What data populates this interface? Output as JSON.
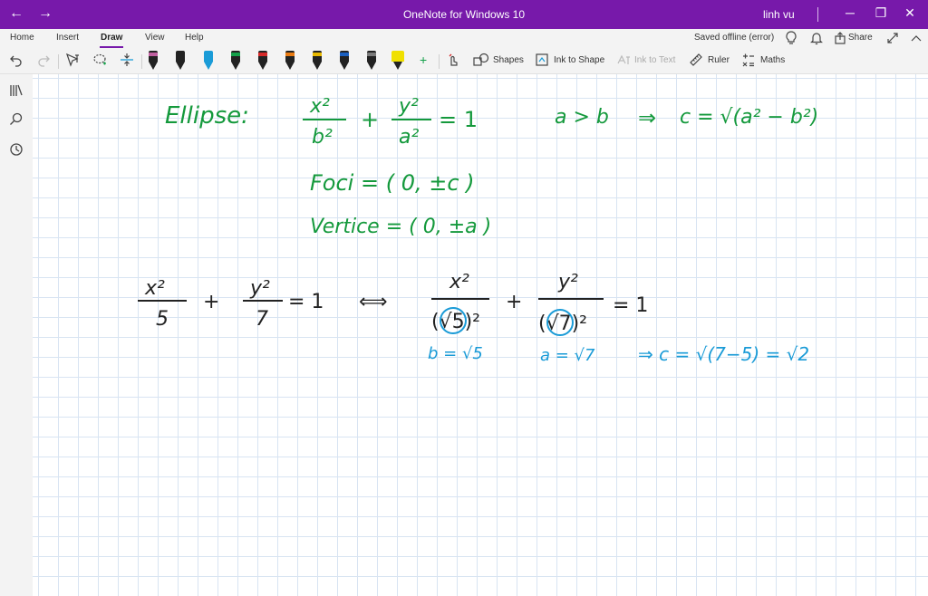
{
  "window": {
    "title": "OneNote for Windows 10",
    "user": "linh vu",
    "back_glyph": "←",
    "forward_glyph": "→",
    "minimize_glyph": "─",
    "restore_glyph": "❐",
    "close_glyph": "✕"
  },
  "menu": {
    "home": "Home",
    "insert": "Insert",
    "draw": "Draw",
    "view": "View",
    "help": "Help",
    "status": "Saved offline (error)",
    "share": "Share"
  },
  "toolbar": {
    "shapes": "Shapes",
    "ink_to_shape": "Ink to Shape",
    "ink_to_text": "Ink to Text",
    "ruler": "Ruler",
    "maths": "Maths",
    "pen_colors": [
      "#c060a0",
      "#222222",
      "#1a9bd7",
      "#14a04a",
      "#d62a2a",
      "#e87a12",
      "#e8b800",
      "#1a5fc0",
      "#7a7a7a",
      "#f0e000"
    ]
  },
  "icons": {
    "undo": "undo-icon",
    "redo": "redo-icon",
    "lasso": "lasso-icon",
    "add_space": "add-space-icon",
    "notebooks": "notebooks-icon",
    "search": "search-icon",
    "recent": "recent-icon",
    "lightbulb": "lightbulb-icon",
    "bell": "bell-icon",
    "share": "share-icon",
    "expand": "expand-icon"
  },
  "colors": {
    "accent": "#7719aa",
    "green_ink": "#14993c",
    "blue_ink": "#1a9bd7"
  },
  "ink": {
    "line1_label": "Ellipse:",
    "line1_condition": "a > b",
    "line1_implies": "⇒",
    "line1_c": "c = √(a² − b²)",
    "foci": "Foci = ( 0, ±c )",
    "vertice": "Vertice = ( 0, ±a )",
    "equiv": "⟺",
    "eq_rhs": "= 1",
    "b_note": "b = √5",
    "a_note": "a = √7",
    "result": "⇒  c = √(7−5) = √2"
  }
}
